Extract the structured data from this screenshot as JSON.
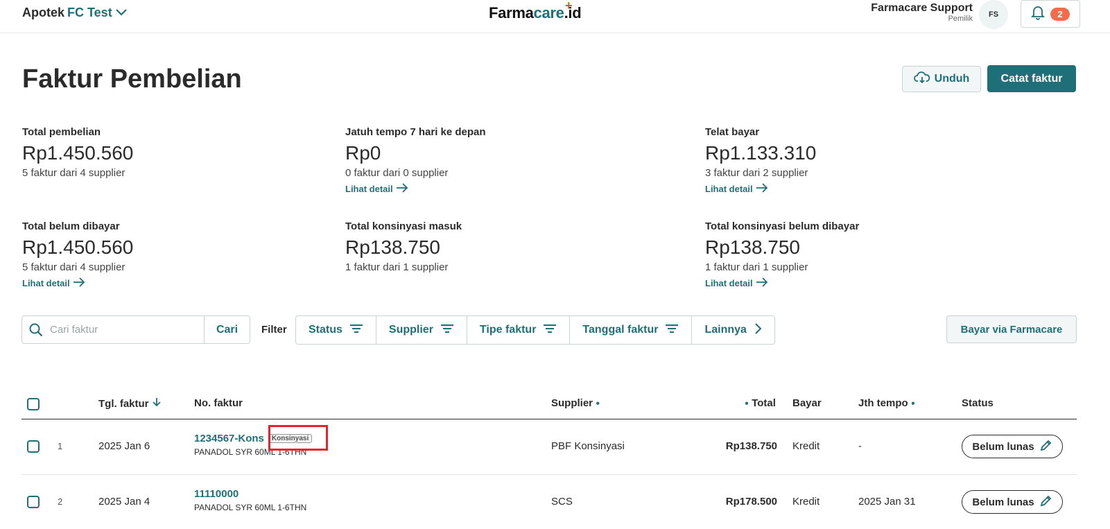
{
  "header": {
    "store_prefix": "Apotek",
    "store_name": "FC Test",
    "logo_main": "Farma",
    "logo_accent": "care",
    "logo_suffix": ".id",
    "user_name": "Farmacare Support",
    "user_role": "Pemilik",
    "avatar_initials": "FS",
    "notification_count": "2"
  },
  "page": {
    "title": "Faktur Pembelian",
    "download_label": "Unduh",
    "record_invoice_label": "Catat faktur"
  },
  "stats": [
    {
      "label": "Total pembelian",
      "value": "Rp1.450.560",
      "sub": "5 faktur dari 4 supplier",
      "link": ""
    },
    {
      "label": "Jatuh tempo 7 hari ke depan",
      "value": "Rp0",
      "sub": "0 faktur dari 0 supplier",
      "link": "Lihat detail"
    },
    {
      "label": "Telat bayar",
      "value": "Rp1.133.310",
      "sub": "3 faktur dari 2 supplier",
      "link": "Lihat detail"
    },
    {
      "label": "Total belum dibayar",
      "value": "Rp1.450.560",
      "sub": "5 faktur dari 4 supplier",
      "link": "Lihat detail"
    },
    {
      "label": "Total konsinyasi masuk",
      "value": "Rp138.750",
      "sub": "1 faktur dari 1 supplier",
      "link": ""
    },
    {
      "label": "Total konsinyasi belum dibayar",
      "value": "Rp138.750",
      "sub": "1 faktur dari 1 supplier",
      "link": "Lihat detail"
    }
  ],
  "search": {
    "placeholder": "Cari faktur",
    "button_label": "Cari"
  },
  "filter": {
    "label": "Filter",
    "items": [
      "Status",
      "Supplier",
      "Tipe faktur",
      "Tanggal faktur",
      "Lainnya"
    ]
  },
  "pay_button_label": "Bayar via Farmacare",
  "table": {
    "headers": {
      "date": "Tgl. faktur",
      "number": "No. faktur",
      "supplier": "Supplier",
      "total": "Total",
      "payment": "Bayar",
      "due": "Jth tempo",
      "status": "Status"
    },
    "rows": [
      {
        "index": "1",
        "date": "2025 Jan 6",
        "number": "1234567-Kons",
        "tag": "Konsinyasi",
        "item": "PANADOL SYR 60ML 1-6THN",
        "supplier": "PBF Konsinyasi",
        "total": "Rp138.750",
        "payment": "Kredit",
        "due": "-",
        "status": "Belum lunas"
      },
      {
        "index": "2",
        "date": "2025 Jan 4",
        "number": "11110000",
        "tag": "",
        "item": "PANADOL SYR 60ML 1-6THN",
        "supplier": "SCS",
        "total": "Rp178.500",
        "payment": "Kredit",
        "due": "2025 Jan 31",
        "status": "Belum lunas"
      }
    ]
  },
  "colors": {
    "primary": "#1f6f78",
    "accent": "#f26b4a",
    "highlight": "#e8212a"
  }
}
